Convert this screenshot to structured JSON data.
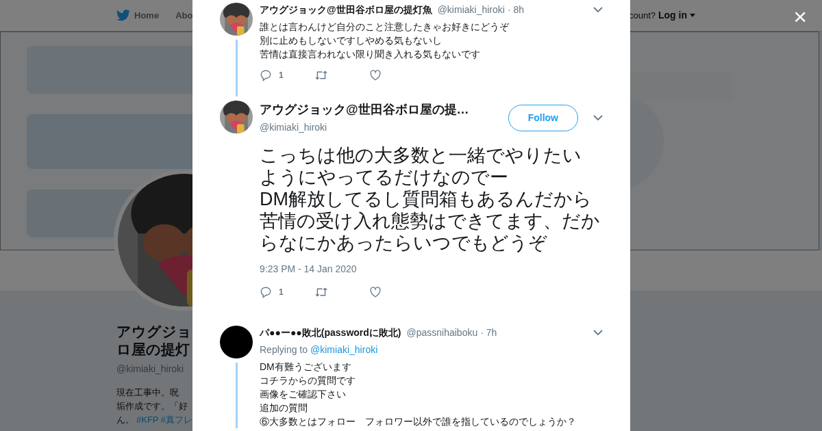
{
  "background_page": {
    "nav": {
      "items": [
        {
          "label": "Home"
        },
        {
          "label": "Abo"
        }
      ],
      "login_prompt": "count?",
      "login_link": "Log in"
    },
    "banner": {
      "kind": "picture"
    },
    "profile": {
      "avatar": {
        "kind": "picture"
      },
      "name_lines": [
        "アウグジョ",
        "ロ屋の提灯"
      ],
      "handle": "@kimiaki_hiroki",
      "bio": [
        {
          "kind": "text",
          "text": "現在工事中。呪"
        },
        {
          "kind": "break"
        },
        {
          "kind": "text",
          "text": "垢作成です。「好"
        },
        {
          "kind": "break"
        },
        {
          "kind": "text",
          "text": "ん。"
        },
        {
          "kind": "hashtag",
          "text": "#KFP"
        },
        {
          "kind": "hashtag",
          "text": "#真フレ"
        }
      ]
    }
  },
  "modal": {
    "close": "×",
    "tweets": [
      {
        "kind": "parent",
        "name": "アウグジョック@世田谷ボロ屋の提灯魚",
        "handle": "@kimiaki_hiroki",
        "time": "· 8h",
        "lines": [
          "誰とは言わんけど自分のこと注意したきゃお好きにどうぞ",
          "別に止めもしないですしやめる気もないし",
          "苦情は直接言われない限り聞き入れる気もないです"
        ],
        "reply_count": "1",
        "thread_line": true
      },
      {
        "kind": "main",
        "name": "アウグジョック@世田谷ボロ屋の提…",
        "handle": "@kimiaki_hiroki",
        "follow": "Follow",
        "lines": [
          "こっちは他の大多数と一緒でやりたい",
          "ようにやってるだけなのでー",
          "DM解放してるし質問箱もあるんだから",
          "苦情の受け入れ態勢はできてます、だからなにかあったらいつでもどうぞ"
        ],
        "timestamp": "9:23 PM - 14 Jan 2020",
        "reply_count": "1",
        "thread_line": false
      },
      {
        "kind": "reply",
        "name": "パ●●ー●●敗北(passwordに敗北)",
        "handle": "@passnihaiboku",
        "time": "· 7h",
        "replying_label": "Replying to",
        "replying_to": "@kimiaki_hiroki",
        "lines": [
          "DM有難うございます",
          "コチラからの質問です",
          "画像をご確認下さい",
          "追加の質問",
          "⑥大多数とはフォロー　フォロワー以外で誰を指しているのでしょうか？"
        ],
        "thread_line": true
      }
    ]
  }
}
